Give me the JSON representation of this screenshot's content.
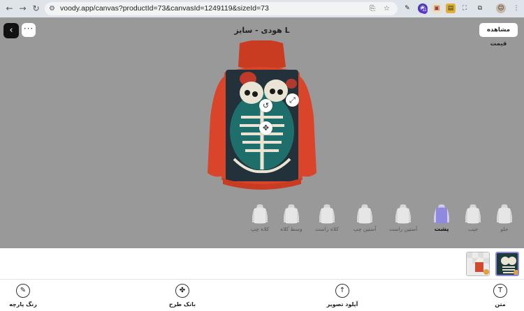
{
  "browser": {
    "url": "voody.app/canvas?productId=73&canvasId=1249119&sizeId=73",
    "extension_badge": "11"
  },
  "editor": {
    "title": "هودی - سایز L",
    "price_button": "مشاهده قیمت",
    "views": [
      {
        "label": "جلو",
        "active": false
      },
      {
        "label": "جیب",
        "active": false
      },
      {
        "label": "پشت",
        "active": true
      },
      {
        "label": "آستین راست",
        "active": false
      },
      {
        "label": "آستین چپ",
        "active": false
      },
      {
        "label": "کلاه راست",
        "active": false
      },
      {
        "label": "وسط کلاه",
        "active": false
      },
      {
        "label": "کلاه چپ",
        "active": false
      }
    ]
  },
  "tools": [
    {
      "label": "متن",
      "icon": "text-icon"
    },
    {
      "label": "آپلود تصویر",
      "icon": "upload-icon"
    },
    {
      "label": "بانک طرح",
      "icon": "design-bank-icon"
    },
    {
      "label": "رنگ پارچه",
      "icon": "brush-icon"
    }
  ],
  "colors": {
    "hoodie": "#d9452a",
    "canvas_bg": "#999999",
    "print_teal": "#1e6f6b",
    "selected_view": "#8f8ae0"
  }
}
